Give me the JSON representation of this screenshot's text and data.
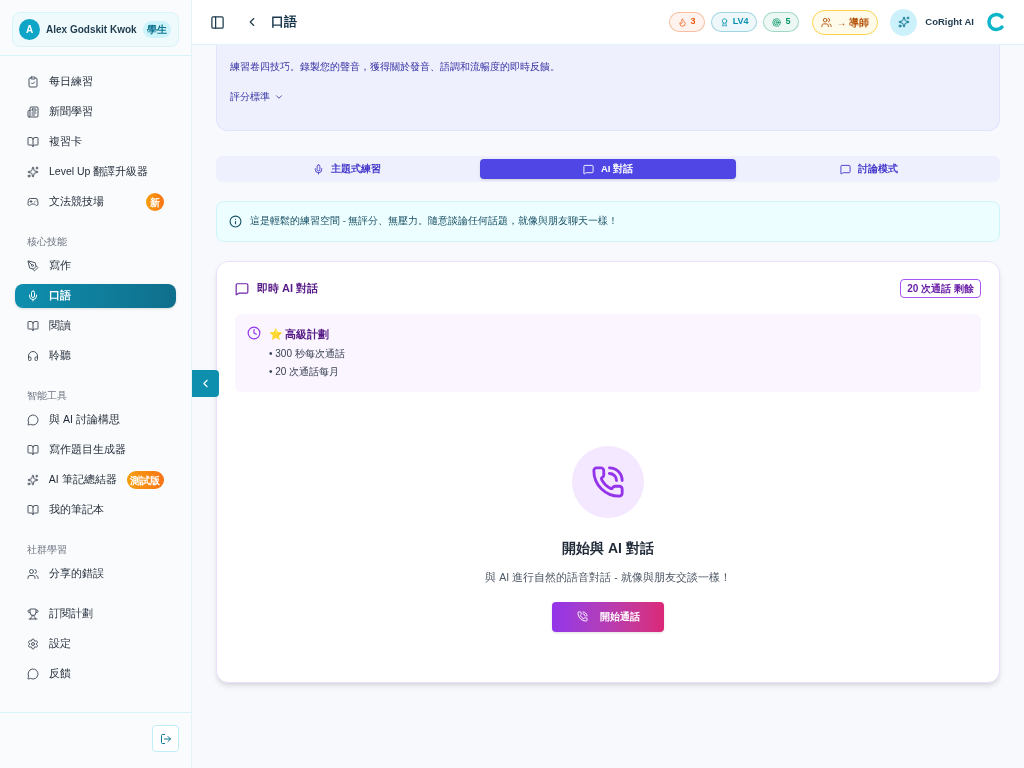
{
  "user": {
    "initial": "A",
    "name": "Alex Godskit Kwok",
    "role": "學生"
  },
  "nav_sections": [
    {
      "items": [
        {
          "label": "每日練習",
          "selected": false
        },
        {
          "label": "新聞學習",
          "selected": false
        },
        {
          "label": "複習卡",
          "selected": false
        },
        {
          "label": "Level Up 翻譯升級器",
          "selected": false
        },
        {
          "label": "文法競技場",
          "selected": false,
          "badge": "新"
        }
      ]
    },
    {
      "heading": "核心技能",
      "items": [
        {
          "label": "寫作",
          "selected": false
        },
        {
          "label": "口語",
          "selected": true
        },
        {
          "label": "閱讀",
          "selected": false
        },
        {
          "label": "聆聽",
          "selected": false
        }
      ]
    },
    {
      "heading": "智能工具",
      "items": [
        {
          "label": "與 AI 討論構思",
          "selected": false
        },
        {
          "label": "寫作題目生成器",
          "selected": false
        },
        {
          "label": "AI 筆記總結器",
          "selected": false,
          "badge": "測試版"
        },
        {
          "label": "我的筆記本",
          "selected": false
        }
      ]
    },
    {
      "heading": "社群學習",
      "items": [
        {
          "label": "分享的錯誤",
          "selected": false
        }
      ]
    },
    {
      "items": [
        {
          "label": "訂閱計劃",
          "selected": false
        },
        {
          "label": "設定",
          "selected": false
        },
        {
          "label": "反饋",
          "selected": false
        }
      ]
    }
  ],
  "header": {
    "title": "口語",
    "stats": [
      {
        "value": "3",
        "color": "#ea580c"
      },
      {
        "value": "LV4",
        "color": "#0891b2"
      },
      {
        "value": "5",
        "color": "#059669"
      }
    ],
    "tutor_button": "→ 導師",
    "assistant": "CoRight AI"
  },
  "intro": {
    "description": "練習卷四技巧。錄製您的聲音，獲得關於發音、語調和流暢度的即時反饋。",
    "criteria_toggle": "評分標準"
  },
  "tabs": [
    {
      "label": "主題式練習",
      "selected": false
    },
    {
      "label": "AI 對話",
      "selected": true
    },
    {
      "label": "討論模式",
      "selected": false
    }
  ],
  "notice": "這是輕鬆的練習空間 - 無評分、無壓力。隨意談論任何話題，就像與朋友聊天一樣！",
  "chat": {
    "title": "即時 AI 對話",
    "remaining": "20 次通話 剩餘",
    "plan": {
      "star": "⭐",
      "name": "高級計劃",
      "features": [
        "• 300 秒每次通話",
        "• 20 次通話每月"
      ]
    },
    "heading": "開始與 AI 對話",
    "subtitle": "與 AI 進行自然的語音對話 - 就像與朋友交談一樣！",
    "start_button": "開始通話"
  }
}
